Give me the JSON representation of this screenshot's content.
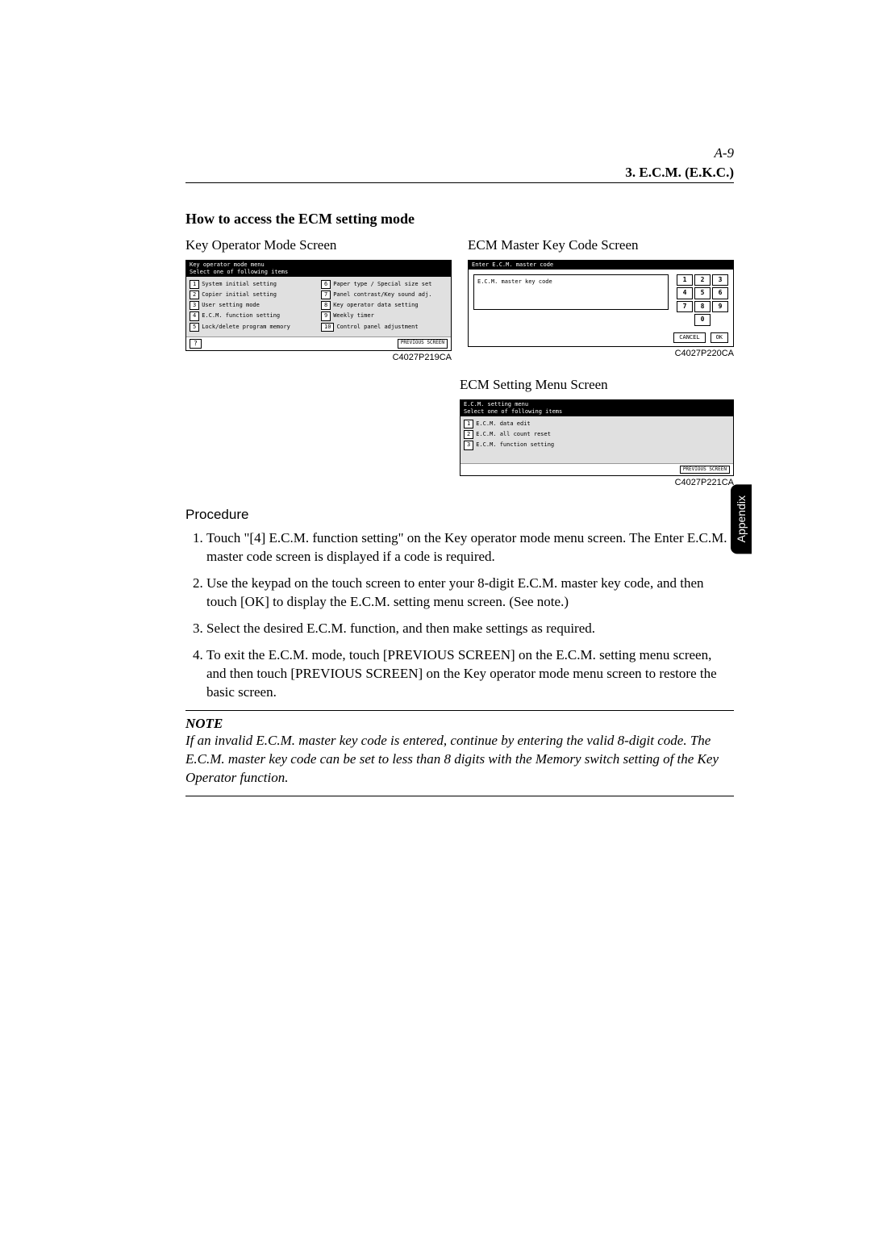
{
  "header": {
    "page_num": "A-9",
    "section": "3. E.C.M. (E.K.C.)"
  },
  "heading": "How to access the ECM setting mode",
  "side_tab": "Appendix",
  "key_operator": {
    "label": "Key Operator Mode Screen",
    "header": "Key operator mode menu\nSelect one of following items",
    "left_items": [
      {
        "n": "1",
        "t": "System initial setting"
      },
      {
        "n": "2",
        "t": "Copier initial setting"
      },
      {
        "n": "3",
        "t": "User setting mode"
      },
      {
        "n": "4",
        "t": "E.C.M. function setting"
      },
      {
        "n": "5",
        "t": "Lock/delete program memory"
      }
    ],
    "right_items": [
      {
        "n": "6",
        "t": "Paper type / Special size set"
      },
      {
        "n": "7",
        "t": "Panel contrast/Key sound adj."
      },
      {
        "n": "8",
        "t": "Key operator data setting"
      },
      {
        "n": "9",
        "t": "Weekly timer"
      },
      {
        "n": "10",
        "t": "Control panel adjustment"
      }
    ],
    "help": "?",
    "prev": "PREVIOUS SCREEN",
    "caption": "C4027P219CA"
  },
  "master_key": {
    "label": "ECM Master Key Code Screen",
    "header": "Enter E.C.M. master code",
    "field_label": "E.C.M. master key code",
    "keys": [
      "1",
      "2",
      "3",
      "4",
      "5",
      "6",
      "7",
      "8",
      "9",
      "0"
    ],
    "cancel": "CANCEL",
    "ok": "OK",
    "caption": "C4027P220CA"
  },
  "ecm_menu": {
    "label": "ECM Setting Menu Screen",
    "header": "E.C.M. setting menu\nSelect one of following items",
    "items": [
      {
        "n": "1",
        "t": "E.C.M. data edit"
      },
      {
        "n": "2",
        "t": "E.C.M. all count reset"
      },
      {
        "n": "3",
        "t": "E.C.M. function setting"
      }
    ],
    "prev": "PREVIOUS SCREEN",
    "caption": "C4027P221CA"
  },
  "procedure": {
    "heading": "Procedure",
    "steps": [
      "Touch \"[4] E.C.M. function setting\" on the Key operator mode menu screen. The Enter E.C.M. master code screen is displayed if a code is required.",
      "Use the keypad on the touch screen to enter your 8-digit E.C.M. master key code, and then touch [OK] to display the E.C.M. setting menu screen. (See note.)",
      "Select the desired E.C.M. function, and then make settings as required.",
      "To exit the E.C.M. mode, touch [PREVIOUS SCREEN] on the E.C.M. setting menu screen, and then touch [PREVIOUS SCREEN] on the Key operator mode menu screen to restore the basic screen."
    ]
  },
  "note": {
    "title": "NOTE",
    "body": "If an invalid E.C.M. master key code is entered, continue by entering the valid 8-digit code. The E.C.M. master key code can be set to less than 8 digits with the Memory switch setting of the Key Operator function."
  }
}
